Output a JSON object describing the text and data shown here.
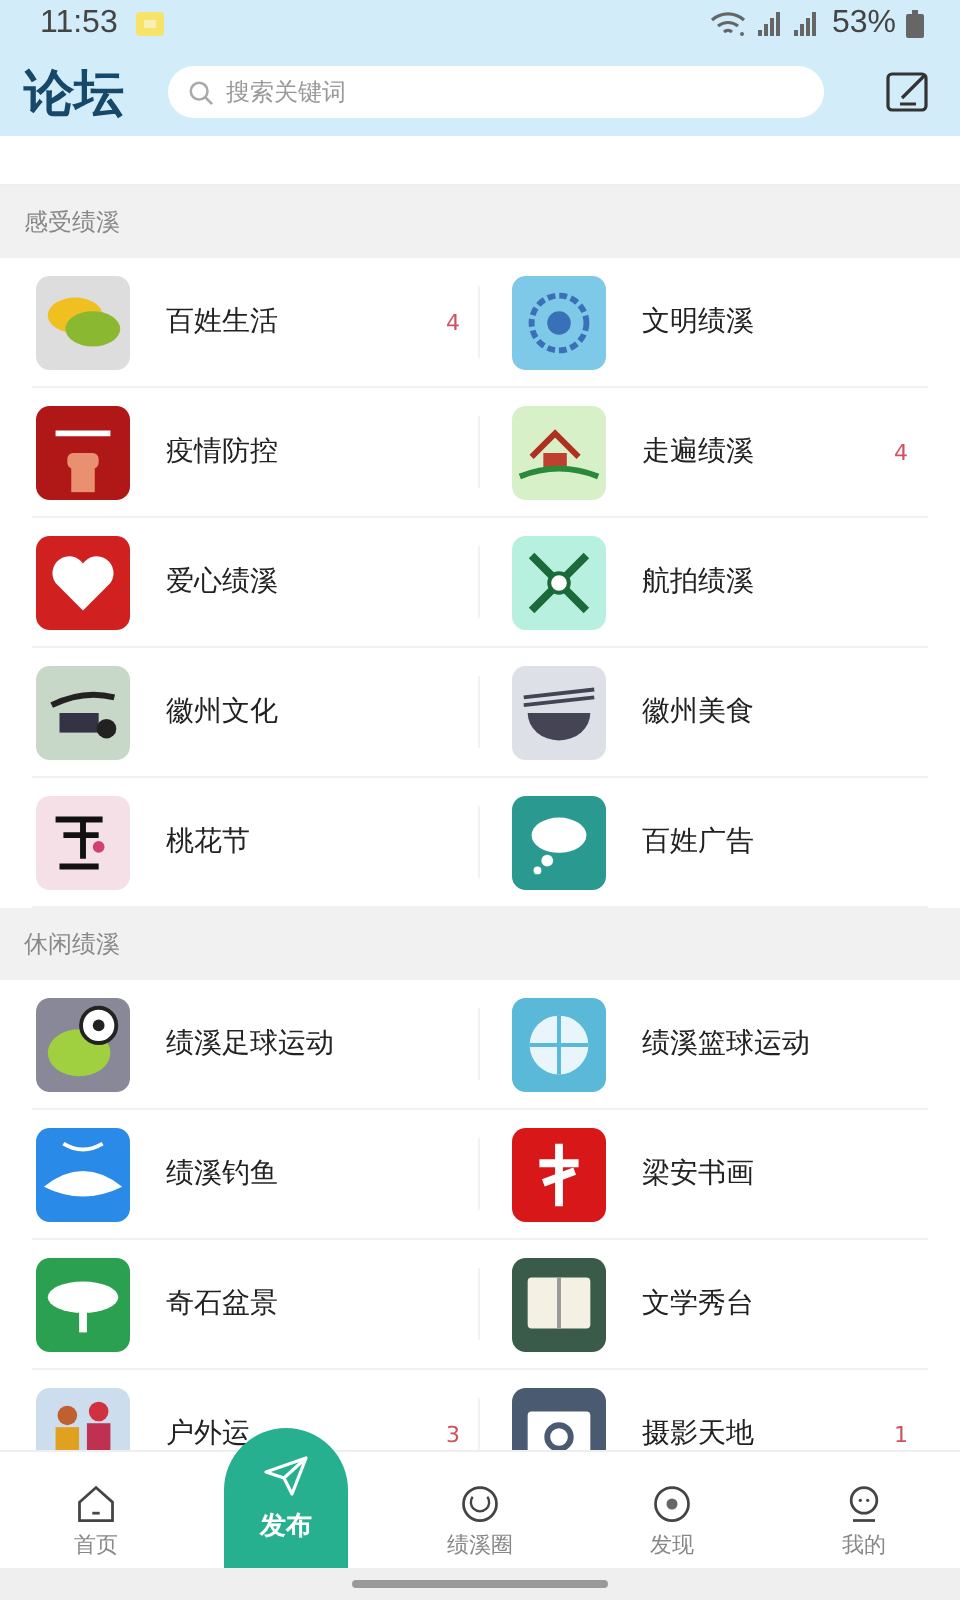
{
  "status_bar": {
    "time": "11:53",
    "battery": "53%"
  },
  "header": {
    "title": "论坛",
    "search": {
      "placeholder": "搜索关键词"
    }
  },
  "sections": [
    {
      "title": "感受绩溪",
      "items": [
        {
          "label": "百姓生活",
          "badge": "4"
        },
        {
          "label": "文明绩溪"
        },
        {
          "label": "疫情防控"
        },
        {
          "label": "走遍绩溪",
          "badge": "4"
        },
        {
          "label": "爱心绩溪"
        },
        {
          "label": "航拍绩溪"
        },
        {
          "label": "徽州文化"
        },
        {
          "label": "徽州美食"
        },
        {
          "label": "桃花节"
        },
        {
          "label": "百姓广告"
        }
      ]
    },
    {
      "title": "休闲绩溪",
      "items": [
        {
          "label": "绩溪足球运动"
        },
        {
          "label": "绩溪篮球运动"
        },
        {
          "label": "绩溪钓鱼"
        },
        {
          "label": "梁安书画"
        },
        {
          "label": "奇石盆景"
        },
        {
          "label": "文学秀台"
        },
        {
          "label": "户外运",
          "badge": "3"
        },
        {
          "label": "摄影天地",
          "badge": "1"
        }
      ]
    }
  ],
  "nav": [
    {
      "kind": "tab",
      "label": "首页"
    },
    {
      "kind": "publish",
      "label": "发布"
    },
    {
      "kind": "tab",
      "label": "绩溪圈"
    },
    {
      "kind": "tab",
      "label": "发现"
    },
    {
      "kind": "tab",
      "label": "我的"
    }
  ]
}
